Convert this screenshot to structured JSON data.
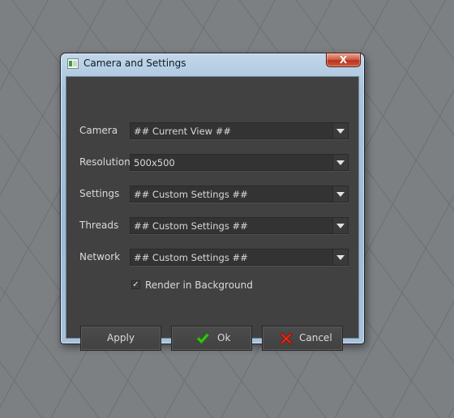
{
  "window": {
    "title": "Camera and Settings",
    "close_label": "X"
  },
  "form": {
    "rows": [
      {
        "label": "Camera",
        "value": "## Current View ##"
      },
      {
        "label": "Resolution",
        "value": "500x500"
      },
      {
        "label": "Settings",
        "value": "## Custom Settings ##"
      },
      {
        "label": "Threads",
        "value": "## Custom Settings ##"
      },
      {
        "label": "Network",
        "value": "## Custom Settings ##"
      }
    ],
    "render_in_background": {
      "label": "Render in Background",
      "checked": true,
      "mark": "✓"
    }
  },
  "buttons": {
    "apply": "Apply",
    "ok": "Ok",
    "cancel": "Cancel"
  },
  "icons": {
    "ok": "green-checkmark-icon",
    "cancel": "red-x-icon"
  },
  "colors": {
    "viewport_bg": "#7d8083",
    "dialog_bg": "#414141",
    "ok_green": "#3cbf1f",
    "cancel_red": "#e0301e"
  }
}
